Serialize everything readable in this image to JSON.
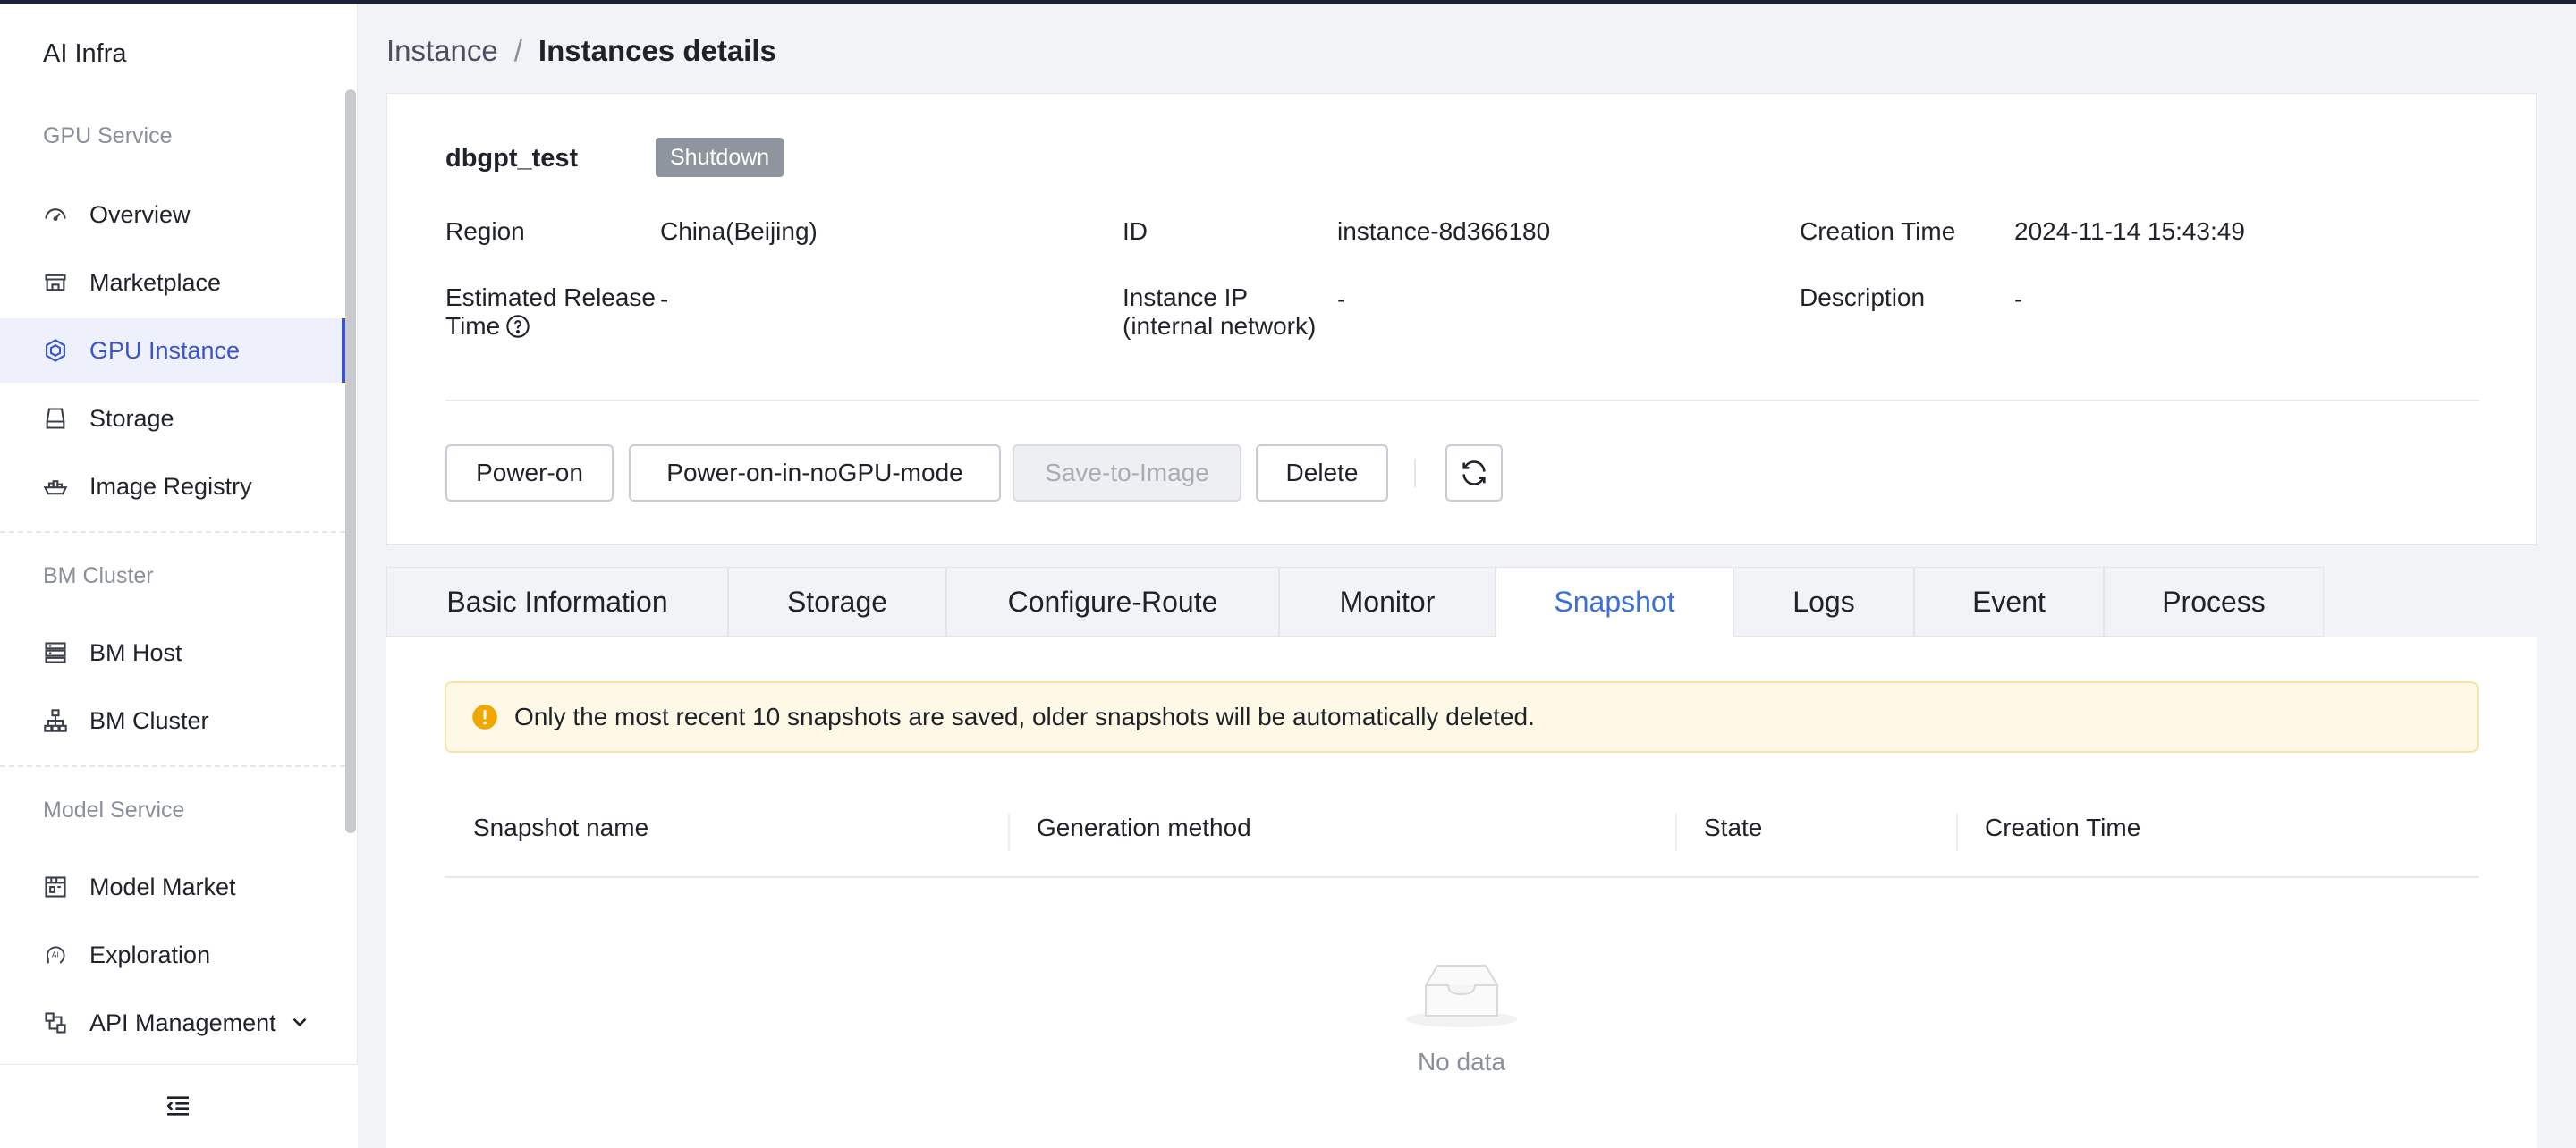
{
  "app": {
    "title": "AI Infra"
  },
  "sidebar": {
    "groups": [
      {
        "title": "GPU Service",
        "items": [
          {
            "label": "Overview",
            "icon": "dashboard-icon"
          },
          {
            "label": "Marketplace",
            "icon": "store-icon"
          },
          {
            "label": "GPU Instance",
            "icon": "gpu-chip-icon",
            "active": true
          },
          {
            "label": "Storage",
            "icon": "hard-drive-icon"
          },
          {
            "label": "Image Registry",
            "icon": "container-ship-icon"
          }
        ]
      },
      {
        "title": "BM Cluster",
        "items": [
          {
            "label": "BM Host",
            "icon": "server-rack-icon"
          },
          {
            "label": "BM Cluster",
            "icon": "cluster-tree-icon"
          }
        ]
      },
      {
        "title": "Model Service",
        "items": [
          {
            "label": "Model Market",
            "icon": "shop-icon"
          },
          {
            "label": "Exploration",
            "icon": "ai-head-icon"
          },
          {
            "label": "API Management",
            "icon": "api-nodes-icon"
          }
        ]
      }
    ]
  },
  "breadcrumb": {
    "parent": "Instance",
    "separator": "/",
    "current": "Instances details"
  },
  "instance": {
    "name": "dbgpt_test",
    "status": "Shutdown",
    "fields": {
      "region_label": "Region",
      "region_value": "China(Beijing)",
      "id_label": "ID",
      "id_value": "instance-8d366180",
      "creation_label": "Creation Time",
      "creation_value": "2024-11-14 15:43:49",
      "release_label_line1": "Estimated Release",
      "release_label_line2": "Time",
      "release_value": "-",
      "ip_label_line1": "Instance IP",
      "ip_label_line2": "(internal network)",
      "ip_value": "-",
      "description_label": "Description",
      "description_value": "-"
    }
  },
  "actions": {
    "power_on": "Power-on",
    "power_on_nogpu": "Power-on-in-noGPU-mode",
    "save_to_image": "Save-to-Image",
    "delete": "Delete"
  },
  "tabs": [
    "Basic Information",
    "Storage",
    "Configure-Route",
    "Monitor",
    "Snapshot",
    "Logs",
    "Event",
    "Process"
  ],
  "active_tab": "Snapshot",
  "snapshot": {
    "alert": "Only the most recent 10 snapshots are saved, older snapshots will be automatically deleted.",
    "columns": [
      "Snapshot name",
      "Generation method",
      "State",
      "Creation Time"
    ],
    "rows": [],
    "empty_text": "No data"
  },
  "colors": {
    "accent": "#3d54c8",
    "tab_active": "#3d6fd9",
    "status_badge": "#8f959e",
    "alert_bg": "#fef9e6",
    "alert_icon": "#f0a800"
  }
}
